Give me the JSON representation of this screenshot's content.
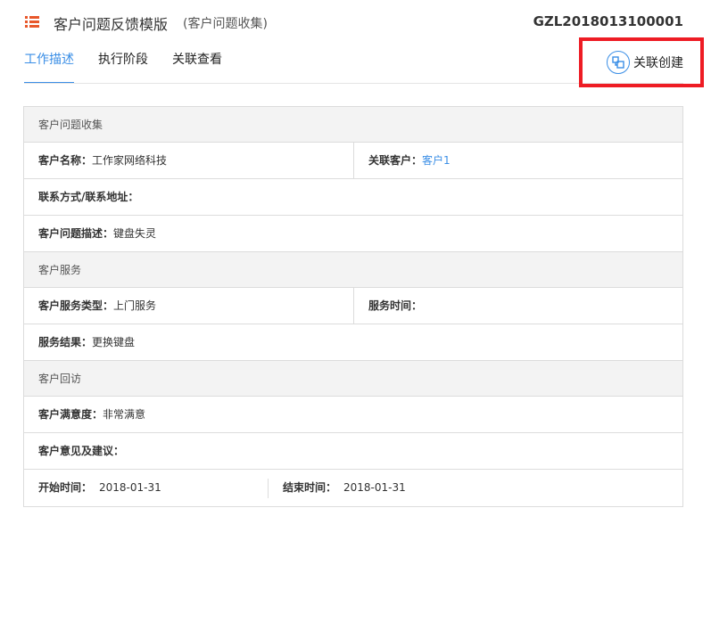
{
  "header": {
    "title": "客户问题反馈模版",
    "subtitle": "(客户问题收集)",
    "doc_number": "GZL2018013100001",
    "icon": "list-icon"
  },
  "tabs": [
    {
      "label": "工作描述",
      "active": true
    },
    {
      "label": "执行阶段",
      "active": false
    },
    {
      "label": "关联查看",
      "active": false
    }
  ],
  "actions": {
    "link_create_label": "关联创建",
    "icon": "link-create-icon"
  },
  "colors": {
    "accent": "#3a8ee6",
    "header_icon": "#e8572a",
    "highlight": "#ee1c24"
  },
  "form": {
    "sections": [
      {
        "title": "客户问题收集",
        "rows": [
          {
            "cells": [
              {
                "label": "客户名称：",
                "value": "工作家网络科技"
              },
              {
                "label": "关联客户：",
                "value": "客户1",
                "link": true
              }
            ]
          },
          {
            "cells": [
              {
                "label": "联系方式/联系地址：",
                "value": ""
              }
            ]
          },
          {
            "cells": [
              {
                "label": "客户问题描述：",
                "value": "键盘失灵"
              }
            ]
          }
        ]
      },
      {
        "title": "客户服务",
        "rows": [
          {
            "cells": [
              {
                "label": "客户服务类型：",
                "value": "上门服务"
              },
              {
                "label": "服务时间：",
                "value": ""
              }
            ]
          },
          {
            "cells": [
              {
                "label": "服务结果：",
                "value": "更换键盘"
              }
            ]
          }
        ]
      },
      {
        "title": "客户回访",
        "rows": [
          {
            "cells": [
              {
                "label": "客户满意度：",
                "value": "非常满意"
              }
            ]
          },
          {
            "cells": [
              {
                "label": "客户意见及建议：",
                "value": ""
              }
            ]
          }
        ]
      }
    ],
    "dates": {
      "start_label": "开始时间：",
      "start_value": "2018-01-31",
      "end_label": "结束时间：",
      "end_value": "2018-01-31"
    }
  }
}
